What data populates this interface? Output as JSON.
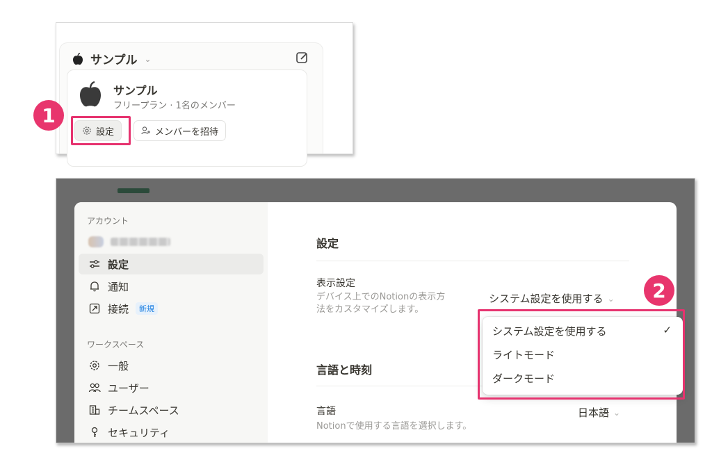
{
  "workspace_panel": {
    "header_name": "サンプル",
    "card_title": "サンプル",
    "card_subtitle": "フリープラン · 1名のメンバー",
    "settings_button": "設定",
    "invite_button": "メンバーを招待"
  },
  "step_badges": [
    "1",
    "2"
  ],
  "settings_modal": {
    "sidebar": {
      "account_section": "アカウント",
      "items_account": [
        {
          "label": "設定",
          "icon": "sliders-icon",
          "active": true
        },
        {
          "label": "通知",
          "icon": "bell-icon"
        },
        {
          "label": "接続",
          "icon": "arrow-up-right-icon",
          "badge": "新規"
        }
      ],
      "workspace_section": "ワークスペース",
      "items_workspace": [
        {
          "label": "一般",
          "icon": "gear-icon"
        },
        {
          "label": "ユーザー",
          "icon": "users-icon"
        },
        {
          "label": "チームスペース",
          "icon": "building-icon"
        },
        {
          "label": "セキュリティ",
          "icon": "key-icon"
        }
      ]
    },
    "main": {
      "heading": "設定",
      "display_title": "表示設定",
      "display_desc_line1": "デバイス上でのNotionの表示方",
      "display_desc_line2": "法をカスタマイズします。",
      "display_value": "システム設定を使用する",
      "time_heading": "言語と時刻",
      "language_title": "言語",
      "language_desc": "Notionで使用する言語を選択します。",
      "language_value": "日本語"
    },
    "theme_dropdown": {
      "options": [
        "システム設定を使用する",
        "ライトモード",
        "ダークモード"
      ],
      "selected": "システム設定を使用する",
      "check": "✓"
    }
  },
  "colors": {
    "highlight": "#e6336f",
    "badge": "#e8356d",
    "accent_blue": "#2383e2"
  }
}
